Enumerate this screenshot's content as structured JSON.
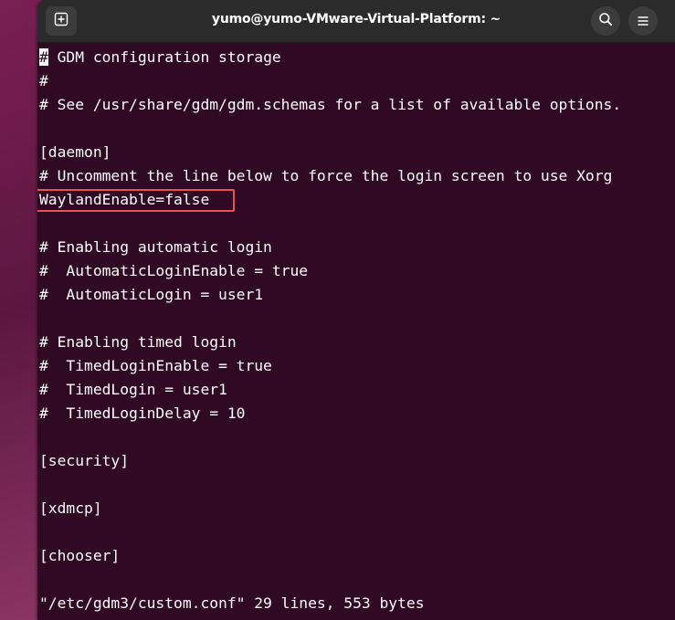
{
  "window": {
    "title": "yumo@yumo-VMware-Virtual-Platform: ~"
  },
  "terminal": {
    "cursor_char": "#",
    "lines": [
      " GDM configuration storage",
      "#",
      "# See /usr/share/gdm/gdm.schemas for a list of available options.",
      "",
      "[daemon]",
      "# Uncomment the line below to force the login screen to use Xorg",
      "WaylandEnable=false",
      "",
      "# Enabling automatic login",
      "#  AutomaticLoginEnable = true",
      "#  AutomaticLogin = user1",
      "",
      "# Enabling timed login",
      "#  TimedLoginEnable = true",
      "#  TimedLogin = user1",
      "#  TimedLoginDelay = 10",
      "",
      "[security]",
      "",
      "[xdmcp]",
      "",
      "[chooser]",
      "",
      "\"/etc/gdm3/custom.conf\" 29 lines, 553 bytes"
    ],
    "highlight_color": "#e8524f",
    "background_color": "#300a24"
  },
  "icons": {
    "new_tab": "new-tab-icon",
    "search": "search-icon",
    "menu": "hamburger-menu-icon"
  }
}
